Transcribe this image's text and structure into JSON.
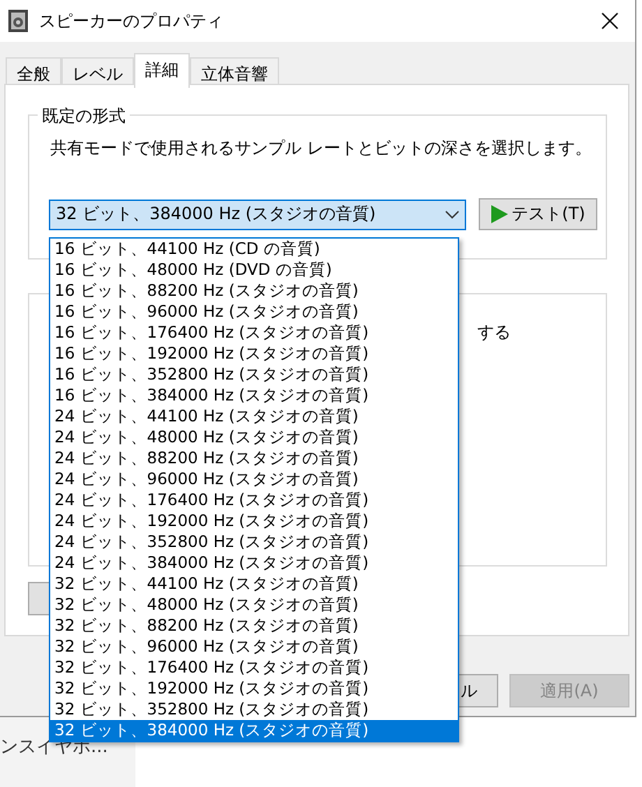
{
  "window": {
    "title": "スピーカーのプロパティ"
  },
  "tabs": [
    {
      "label": "全般",
      "selected": false
    },
    {
      "label": "レベル",
      "selected": false
    },
    {
      "label": "詳細",
      "selected": true
    },
    {
      "label": "立体音響",
      "selected": false
    }
  ],
  "format_group": {
    "legend": "既定の形式",
    "description": "共有モードで使用されるサンプル レートとビットの深さを選択します。",
    "combo": {
      "value": "32 ビット、384000 Hz (スタジオの音質)",
      "expanded": true
    },
    "test_button": "テスト(T)"
  },
  "format_options": [
    {
      "label": "16 ビット、44100 Hz (CD の音質)",
      "selected": false
    },
    {
      "label": "16 ビット、48000 Hz (DVD の音質)",
      "selected": false
    },
    {
      "label": "16 ビット、88200 Hz (スタジオの音質)",
      "selected": false
    },
    {
      "label": "16 ビット、96000 Hz (スタジオの音質)",
      "selected": false
    },
    {
      "label": "16 ビット、176400 Hz (スタジオの音質)",
      "selected": false
    },
    {
      "label": "16 ビット、192000 Hz (スタジオの音質)",
      "selected": false
    },
    {
      "label": "16 ビット、352800 Hz (スタジオの音質)",
      "selected": false
    },
    {
      "label": "16 ビット、384000 Hz (スタジオの音質)",
      "selected": false
    },
    {
      "label": "24 ビット、44100 Hz (スタジオの音質)",
      "selected": false
    },
    {
      "label": "24 ビット、48000 Hz (スタジオの音質)",
      "selected": false
    },
    {
      "label": "24 ビット、88200 Hz (スタジオの音質)",
      "selected": false
    },
    {
      "label": "24 ビット、96000 Hz (スタジオの音質)",
      "selected": false
    },
    {
      "label": "24 ビット、176400 Hz (スタジオの音質)",
      "selected": false
    },
    {
      "label": "24 ビット、192000 Hz (スタジオの音質)",
      "selected": false
    },
    {
      "label": "24 ビット、352800 Hz (スタジオの音質)",
      "selected": false
    },
    {
      "label": "24 ビット、384000 Hz (スタジオの音質)",
      "selected": false
    },
    {
      "label": "32 ビット、44100 Hz (スタジオの音質)",
      "selected": false
    },
    {
      "label": "32 ビット、48000 Hz (スタジオの音質)",
      "selected": false
    },
    {
      "label": "32 ビット、88200 Hz (スタジオの音質)",
      "selected": false
    },
    {
      "label": "32 ビット、96000 Hz (スタジオの音質)",
      "selected": false
    },
    {
      "label": "32 ビット、176400 Hz (スタジオの音質)",
      "selected": false
    },
    {
      "label": "32 ビット、192000 Hz (スタジオの音質)",
      "selected": false
    },
    {
      "label": "32 ビット、352800 Hz (スタジオの音質)",
      "selected": false
    },
    {
      "label": "32 ビット、384000 Hz (スタジオの音質)",
      "selected": true
    }
  ],
  "exclusive_group": {
    "option_text": "する"
  },
  "buttons": [
    {
      "label": "ル",
      "disabled": false
    },
    {
      "label": "適用(A)",
      "disabled": true
    }
  ],
  "background": {
    "text": "ンスイヤホ..."
  }
}
